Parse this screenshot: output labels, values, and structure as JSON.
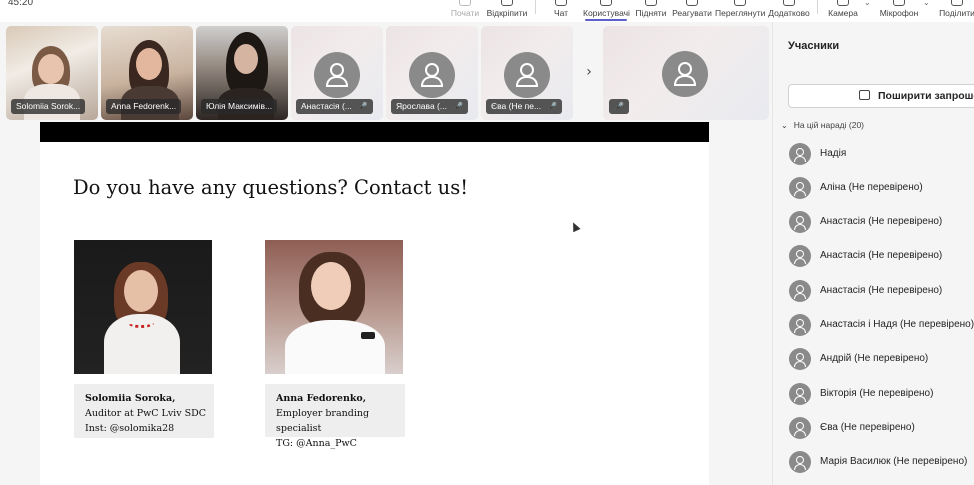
{
  "toolbar": {
    "timer": "45:20",
    "items": [
      {
        "label": "Почати",
        "icon": "record-icon"
      },
      {
        "label": "Відкріпити",
        "icon": "unpin-icon"
      },
      {
        "label": "Чат",
        "icon": "chat-icon"
      },
      {
        "label": "Користувачі",
        "icon": "people-icon"
      },
      {
        "label": "Підняти",
        "icon": "raise-hand-icon"
      },
      {
        "label": "Реагувати",
        "icon": "react-icon"
      },
      {
        "label": "Переглянути",
        "icon": "view-icon"
      },
      {
        "label": "Додатково",
        "icon": "more-icon"
      },
      {
        "label": "Камера",
        "icon": "camera-icon"
      },
      {
        "label": "Мікрофон",
        "icon": "microphone-icon"
      },
      {
        "label": "Поділити",
        "icon": "share-icon"
      }
    ]
  },
  "strip": {
    "tiles": [
      {
        "name": "Solomiia Sorok..."
      },
      {
        "name": "Anna Fedorenk..."
      },
      {
        "name": "Юлія Максимів..."
      },
      {
        "name": "Анастасія (..."
      },
      {
        "name": "Ярослава (..."
      },
      {
        "name": "Єва (Не пе..."
      }
    ],
    "next_icon": "chevron-right-icon"
  },
  "slide": {
    "title": "Do you have any questions? Contact us!",
    "contacts": [
      {
        "name": "Solomiia Soroka,",
        "role": "Auditor at PwC Lviv SDC",
        "handle": "Inst: @solomika28"
      },
      {
        "name": "Anna Fedorenko,",
        "role": "Employer branding specialist",
        "handle": "TG: @Anna_PwC"
      }
    ]
  },
  "panel": {
    "title": "Учасники",
    "share_invite": "Поширити запрошення",
    "section": "На цій нараді (20)",
    "participants": [
      "Надія",
      "Аліна (Не перевірено)",
      "Анастасія (Не перевірено)",
      "Анастасія (Не перевірено)",
      "Анастасія (Не перевірено)",
      "Анастасія і Надя (Не перевірено)",
      "Андрій (Не перевірено)",
      "Вікторія (Не перевірено)",
      "Єва (Не перевірено)",
      "Марія Василюк (Не перевірено)"
    ]
  },
  "colors": {
    "accent": "#5b5fc7",
    "pill": "#292929",
    "avatar": "#8a8a8a"
  }
}
